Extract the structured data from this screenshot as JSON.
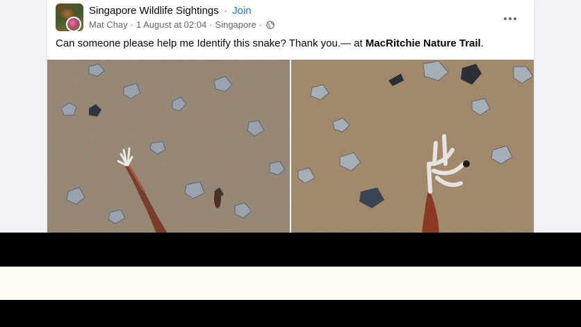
{
  "post": {
    "group_name": "Singapore Wildlife Sightings",
    "separator": "·",
    "join_label": "Join",
    "author": "Mat Chay",
    "timestamp": "1 August at 02:04",
    "location": "Singapore",
    "audience_icon": "globe-icon",
    "more_icon": "more-options-icon",
    "text_prefix": "Can someone please help me Identify this snake? Thank you.— at ",
    "place": "MacRitchie Nature Trail",
    "text_suffix": "."
  },
  "colors": {
    "link": "#1877f2",
    "text": "#050505",
    "secondary": "#65676b",
    "background": "#f0f2f5"
  }
}
